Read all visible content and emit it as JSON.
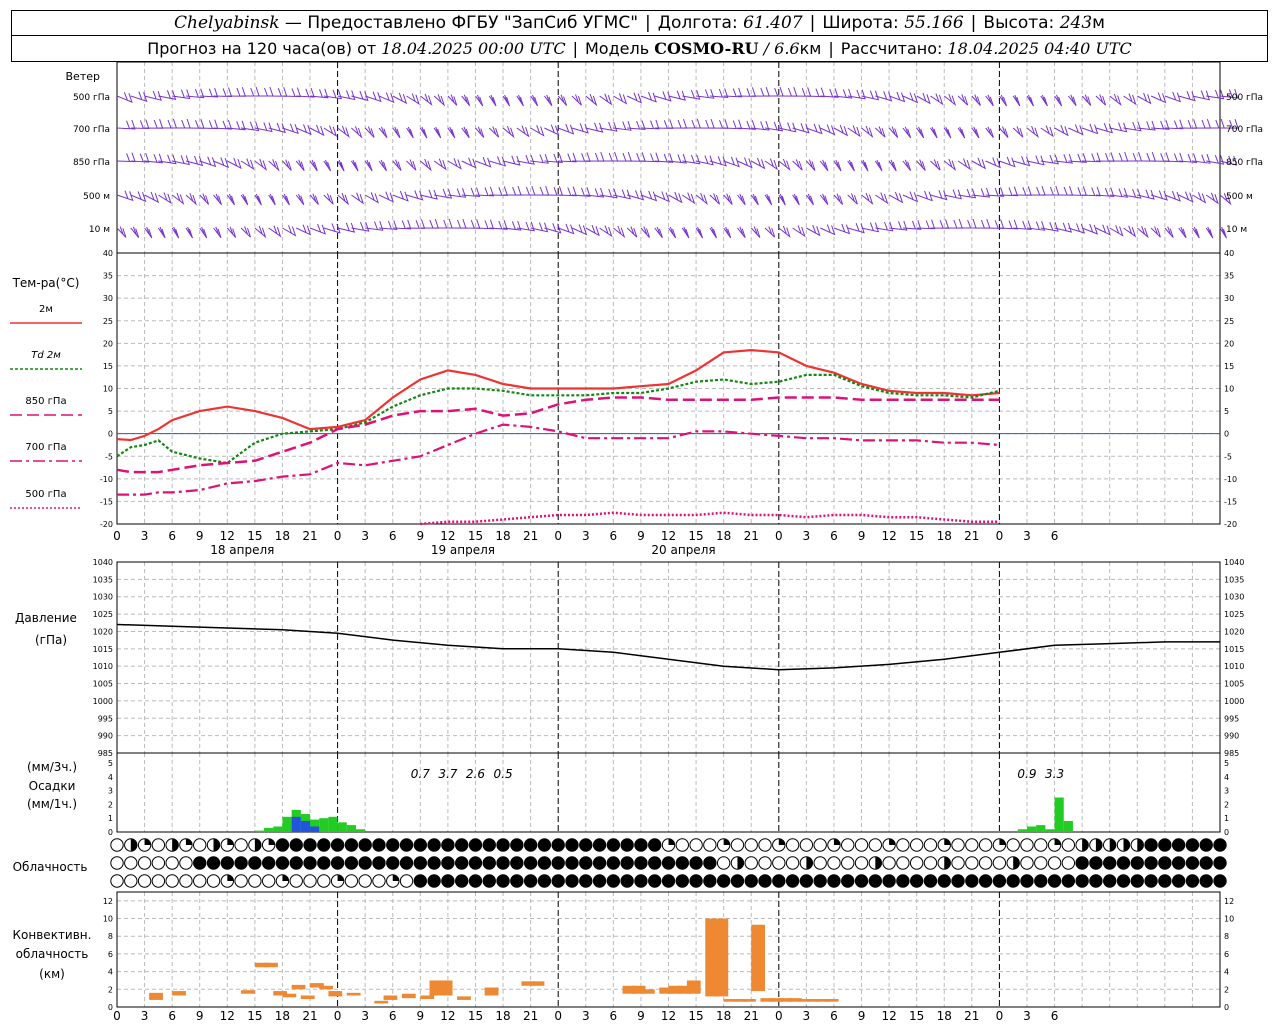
{
  "header": {
    "city": "Chelyabinsk",
    "provider": "— Предоставлено ФГБУ \"ЗапСиб УГМС\"",
    "lon_label": "Долгота:",
    "lon_value": "61.407",
    "lat_label": "Широта:",
    "lat_value": "55.166",
    "alt_label": "Высота:",
    "alt_value": "243",
    "alt_unit": "м",
    "forecast_label": "Прогноз на 120 часа(ов) от",
    "forecast_start": "18.04.2025 00:00 UTC",
    "model_label": "Модель",
    "model_name": "COSMO-RU",
    "model_res": "/ 6.6",
    "model_res_unit": "км",
    "computed_label": "Рассчитано:",
    "computed_at": "18.04.2025 04:40 UTC"
  },
  "colors": {
    "t2m": "#ee3333",
    "td2m": "#118811",
    "t850": "#dd1177",
    "t700": "#dd1177",
    "t500": "#dd1177",
    "wind": "#7733cc",
    "pressure": "#000000",
    "precip_rain": "#22cc22",
    "precip_snow": "#2255dd",
    "convective": "#ee8833",
    "zero_line": "#3355dd"
  },
  "chart_data": [
    {
      "panel": "wind",
      "type": "wind-barbs",
      "title": "Ветер",
      "levels": [
        "500 гПа",
        "700 гПа",
        "850 гПа",
        "500 м",
        "10 м"
      ]
    },
    {
      "panel": "temperature",
      "type": "line",
      "title": "Тем-ра(°C)",
      "ylim": [
        -20,
        40
      ],
      "yticks": [
        40,
        35,
        30,
        25,
        20,
        15,
        10,
        5,
        0,
        -5,
        -10,
        -15,
        -20
      ],
      "legend": [
        "2м",
        "Td 2м",
        "850 гПа",
        "700 гПа",
        "500 гПа"
      ],
      "x_hours": [
        0,
        1.5,
        3,
        4.5,
        6,
        9,
        12,
        15,
        18,
        21,
        24,
        27,
        30,
        33,
        36,
        39,
        42,
        45,
        48,
        51,
        54,
        57,
        60,
        63,
        66,
        69,
        72,
        75,
        78,
        81,
        84,
        87,
        90,
        93,
        96,
        99,
        102,
        105,
        108,
        111,
        114,
        117,
        120
      ],
      "series": [
        {
          "name": "2м",
          "values": [
            -1.2,
            -1.4,
            -0.5,
            1.0,
            3.0,
            5.0,
            6.0,
            5.0,
            3.5,
            1.0,
            1.5,
            3.0,
            8.0,
            12.0,
            14.0,
            13.0,
            11.0,
            10.0,
            10.0,
            10.0,
            10.0,
            10.5,
            11.0,
            14.0,
            18.0,
            18.5,
            18.0,
            15.0,
            13.5,
            11.0,
            9.5,
            9.0,
            9.0,
            8.5,
            9.0
          ]
        },
        {
          "name": "Td 2м",
          "values": [
            -5.0,
            -3.0,
            -2.5,
            -1.5,
            -4.0,
            -5.5,
            -6.5,
            -2.0,
            0.0,
            0.5,
            1.0,
            2.5,
            6.0,
            8.5,
            10.0,
            10.0,
            9.5,
            8.5,
            8.5,
            8.5,
            9.0,
            9.0,
            10.0,
            11.5,
            12.0,
            11.0,
            11.5,
            13.0,
            13.0,
            10.5,
            9.0,
            8.5,
            8.5,
            8.0,
            9.5
          ]
        },
        {
          "name": "850 гПа",
          "values": [
            -8.0,
            -8.5,
            -8.5,
            -8.5,
            -8.0,
            -7.0,
            -6.5,
            -6.0,
            -4.0,
            -2.0,
            1.0,
            2.0,
            4.0,
            5.0,
            5.0,
            5.5,
            4.0,
            4.5,
            6.5,
            7.5,
            8.0,
            8.0,
            7.5,
            7.5,
            7.5,
            7.5,
            8.0,
            8.0,
            8.0,
            7.5,
            7.5,
            7.5,
            7.5,
            7.5,
            7.5
          ]
        },
        {
          "name": "700 гПа",
          "values": [
            -13.5,
            -13.5,
            -13.5,
            -13.0,
            -13.0,
            -12.5,
            -11.0,
            -10.5,
            -9.5,
            -9.0,
            -6.5,
            -7.0,
            -6.0,
            -5.0,
            -2.5,
            0.0,
            2.0,
            1.5,
            0.5,
            -1.0,
            -1.0,
            -1.0,
            -1.0,
            0.5,
            0.5,
            0.0,
            -0.5,
            -1.0,
            -1.0,
            -1.5,
            -1.5,
            -1.5,
            -2.0,
            -2.0,
            -2.5
          ]
        },
        {
          "name": "500 гПа",
          "values": [
            null,
            null,
            null,
            null,
            null,
            null,
            null,
            null,
            null,
            null,
            null,
            null,
            null,
            -20.0,
            -19.5,
            -19.5,
            -19.0,
            -18.5,
            -18.0,
            -18.0,
            -17.5,
            -18.0,
            -18.0,
            -18.0,
            -17.5,
            -18.0,
            -18.0,
            -18.5,
            -18.0,
            -18.0,
            -18.5,
            -18.5,
            -19.0,
            -19.5,
            -19.5
          ]
        }
      ],
      "xticks": [
        "0",
        "3",
        "6",
        "9",
        "12",
        "15",
        "18",
        "21",
        "0",
        "3",
        "6",
        "9",
        "12",
        "15",
        "18",
        "21",
        "0",
        "3",
        "6",
        "9",
        "12",
        "15",
        "18",
        "21",
        "0",
        "3",
        "6",
        "9",
        "12",
        "15",
        "18",
        "21",
        "0",
        "3",
        "6"
      ],
      "dates": [
        "18 апреля",
        "19 апреля",
        "20 апреля"
      ]
    },
    {
      "panel": "pressure",
      "type": "line",
      "title": "Давление",
      "unit": "(гПа)",
      "ylim": [
        985,
        1040
      ],
      "yticks": [
        1040,
        1035,
        1030,
        1025,
        1020,
        1015,
        1010,
        1005,
        1000,
        995,
        990,
        985
      ],
      "x_hours": [
        0,
        6,
        12,
        18,
        24,
        30,
        36,
        42,
        48,
        54,
        60,
        66,
        72,
        78,
        84,
        90,
        96,
        102,
        108,
        114,
        120
      ],
      "values": [
        1022,
        1021.5,
        1021,
        1020.5,
        1019.5,
        1017.5,
        1016,
        1015,
        1015,
        1014,
        1012,
        1010,
        1009,
        1009.5,
        1010.5,
        1012,
        1014,
        1016,
        1016.5,
        1017,
        1017
      ]
    },
    {
      "panel": "precipitation",
      "type": "bar",
      "title": "Осадки",
      "unit_3h": "(мм/3ч.)",
      "unit_1h": "(мм/1ч.)",
      "ylim": [
        0,
        5
      ],
      "yticks": [
        5,
        4,
        3,
        2,
        1,
        0
      ],
      "totals": [
        {
          "hour": 33,
          "label": "0.7"
        },
        {
          "hour": 36,
          "label": "3.7"
        },
        {
          "hour": 39,
          "label": "2.6"
        },
        {
          "hour": 42,
          "label": "0.5"
        },
        {
          "hour": 99,
          "label": "0.9"
        },
        {
          "hour": 102,
          "label": "3.3"
        }
      ],
      "rain": [
        {
          "hour": 16,
          "value": 0.1
        },
        {
          "hour": 17,
          "value": 0.3
        },
        {
          "hour": 18,
          "value": 0.4
        },
        {
          "hour": 19,
          "value": 1.1
        },
        {
          "hour": 20,
          "value": 1.6
        },
        {
          "hour": 21,
          "value": 1.3
        },
        {
          "hour": 22,
          "value": 0.9
        },
        {
          "hour": 23,
          "value": 1.0
        },
        {
          "hour": 24,
          "value": 1.1
        },
        {
          "hour": 25,
          "value": 0.7
        },
        {
          "hour": 26,
          "value": 0.5
        },
        {
          "hour": 27,
          "value": 0.2
        },
        {
          "hour": 99,
          "value": 0.2
        },
        {
          "hour": 100,
          "value": 0.4
        },
        {
          "hour": 101,
          "value": 0.5
        },
        {
          "hour": 102,
          "value": 0.2
        },
        {
          "hour": 103,
          "value": 2.5
        },
        {
          "hour": 104,
          "value": 0.8
        }
      ],
      "snow": [
        {
          "hour": 20,
          "value": 1.1
        },
        {
          "hour": 21,
          "value": 0.8
        },
        {
          "hour": 22,
          "value": 0.4
        }
      ]
    },
    {
      "panel": "cloudiness",
      "type": "table",
      "title": "Облачность",
      "rows": [
        "upper",
        "middle",
        "lower"
      ]
    },
    {
      "panel": "convective",
      "type": "bar",
      "title": "Конвективн.",
      "title2": "облачность",
      "unit": "(км)",
      "ylim": [
        0,
        13
      ],
      "yticks": [
        12,
        10,
        8,
        6,
        4,
        2,
        0
      ],
      "bars": [
        {
          "hour": 4.5,
          "base": 0.8,
          "top": 1.6
        },
        {
          "hour": 7,
          "base": 1.3,
          "top": 1.8
        },
        {
          "hour": 14.5,
          "base": 1.5,
          "top": 1.9
        },
        {
          "hour": 16,
          "base": 4.5,
          "top": 5.0
        },
        {
          "hour": 17,
          "base": 4.5,
          "top": 5.0
        },
        {
          "hour": 18,
          "base": 1.3,
          "top": 1.8
        },
        {
          "hour": 19,
          "base": 1.1,
          "top": 1.5
        },
        {
          "hour": 20,
          "base": 2.0,
          "top": 2.5
        },
        {
          "hour": 21,
          "base": 0.9,
          "top": 1.3
        },
        {
          "hour": 22,
          "base": 2.2,
          "top": 2.7
        },
        {
          "hour": 23,
          "base": 2.0,
          "top": 2.4
        },
        {
          "hour": 24,
          "base": 1.2,
          "top": 1.8
        },
        {
          "hour": 26,
          "base": 1.3,
          "top": 1.6
        },
        {
          "hour": 29,
          "base": 0.4,
          "top": 0.7
        },
        {
          "hour": 30,
          "base": 0.8,
          "top": 1.3
        },
        {
          "hour": 32,
          "base": 1.0,
          "top": 1.5
        },
        {
          "hour": 34,
          "base": 0.9,
          "top": 1.3
        },
        {
          "hour": 35,
          "base": 1.3,
          "top": 3.0
        },
        {
          "hour": 36,
          "base": 1.3,
          "top": 3.0
        },
        {
          "hour": 38,
          "base": 0.8,
          "top": 1.2
        },
        {
          "hour": 41,
          "base": 1.3,
          "top": 2.2
        },
        {
          "hour": 45,
          "base": 2.4,
          "top": 2.9
        },
        {
          "hour": 46,
          "base": 2.4,
          "top": 2.9
        },
        {
          "hour": 56,
          "base": 1.5,
          "top": 2.4
        },
        {
          "hour": 57,
          "base": 1.5,
          "top": 2.4
        },
        {
          "hour": 58,
          "base": 1.5,
          "top": 2.0
        },
        {
          "hour": 60,
          "base": 1.5,
          "top": 2.2
        },
        {
          "hour": 61,
          "base": 1.5,
          "top": 2.4
        },
        {
          "hour": 62,
          "base": 1.5,
          "top": 2.4
        },
        {
          "hour": 63,
          "base": 1.5,
          "top": 3.0
        },
        {
          "hour": 65,
          "base": 1.2,
          "top": 10.0
        },
        {
          "hour": 66,
          "base": 1.2,
          "top": 10.0
        },
        {
          "hour": 67,
          "base": 0.6,
          "top": 0.9
        },
        {
          "hour": 68,
          "base": 0.6,
          "top": 0.9
        },
        {
          "hour": 69,
          "base": 0.6,
          "top": 0.9
        },
        {
          "hour": 70,
          "base": 1.8,
          "top": 9.3
        },
        {
          "hour": 71,
          "base": 0.6,
          "top": 1.0
        },
        {
          "hour": 72,
          "base": 0.6,
          "top": 1.0
        },
        {
          "hour": 73,
          "base": 0.6,
          "top": 1.0
        },
        {
          "hour": 74,
          "base": 0.6,
          "top": 1.0
        },
        {
          "hour": 75,
          "base": 0.6,
          "top": 0.9
        },
        {
          "hour": 76,
          "base": 0.6,
          "top": 0.9
        },
        {
          "hour": 77,
          "base": 0.6,
          "top": 0.9
        },
        {
          "hour": 78,
          "base": 0.6,
          "top": 0.9
        }
      ]
    }
  ]
}
